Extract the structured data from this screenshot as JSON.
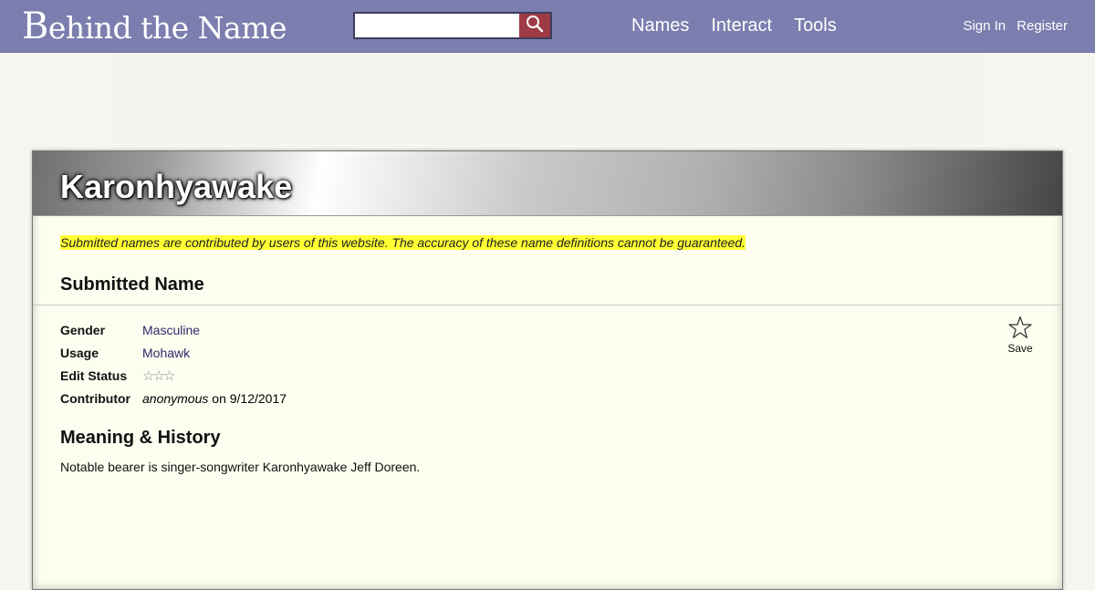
{
  "header": {
    "logo_first": "B",
    "logo_rest": "ehind the Name",
    "search": {
      "value": "",
      "placeholder": ""
    },
    "nav": [
      "Names",
      "Interact",
      "Tools"
    ],
    "account": {
      "sign_in": "Sign In",
      "register": "Register"
    }
  },
  "name": {
    "title": "Karonhyawake",
    "disclaimer": "Submitted names are contributed by users of this website. The accuracy of these name definitions cannot be guaranteed.",
    "section_heading": "Submitted Name",
    "fields": {
      "gender_label": "Gender",
      "gender_value": "Masculine",
      "usage_label": "Usage",
      "usage_value": "Mohawk",
      "edit_status_label": "Edit Status",
      "edit_status_stars": "☆☆☆",
      "contributor_label": "Contributor",
      "contributor_name": "anonymous",
      "contributor_date": " on 9/12/2017"
    },
    "save_label": "Save",
    "meaning_heading": "Meaning & History",
    "meaning_text": "Notable bearer is singer-songwriter Karonhyawake Jeff Doreen."
  },
  "colors": {
    "topbar": "#7b7eae",
    "search_button": "#9e3a44",
    "highlight": "#ffff33",
    "card_bg": "#fdfdf0",
    "link": "#2b2b6b"
  },
  "icons": {
    "search": "search-icon",
    "save": "star-outline-icon"
  }
}
